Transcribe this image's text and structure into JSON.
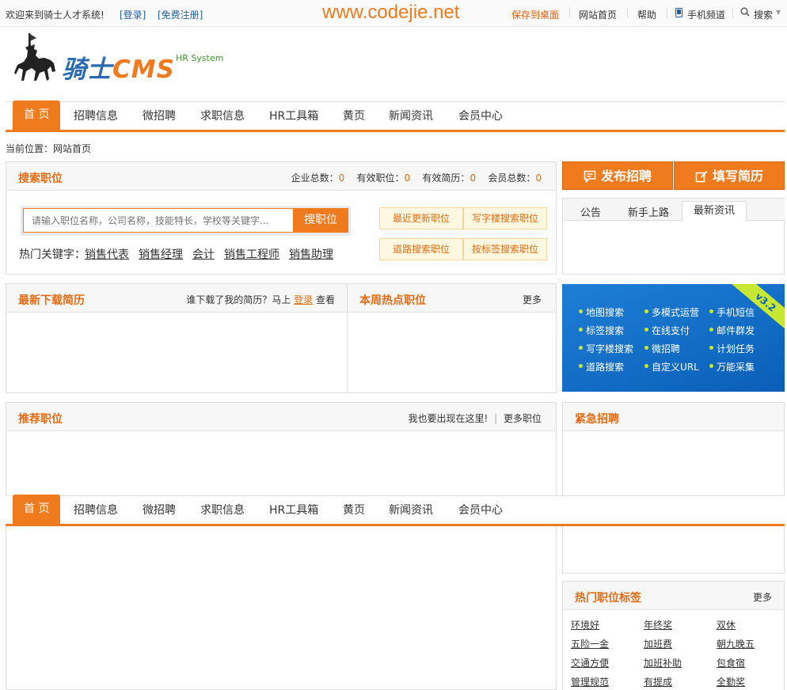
{
  "topbar": {
    "welcome": "欢迎来到骑士人才系统!",
    "login": "[登录]",
    "register": "[免费注册]",
    "brand_watermark": "www.codejie.net",
    "save_desktop": "保存到桌面",
    "home": "网站首页",
    "help": "帮助",
    "mobile": "手机频道",
    "search": "搜索"
  },
  "logo": {
    "title": "骑士",
    "title_cms": "CMS",
    "subtitle": "HR System"
  },
  "nav": {
    "items": [
      "首 页",
      "招聘信息",
      "微招聘",
      "求职信息",
      "HR工具箱",
      "黄页",
      "新闻资讯",
      "会员中心"
    ]
  },
  "breadcrumb": "当前位置：网站首页",
  "search_panel": {
    "title": "搜索职位",
    "stats": [
      {
        "label": "企业总数：",
        "value": "0"
      },
      {
        "label": "有效职位：",
        "value": "0"
      },
      {
        "label": "有效简历：",
        "value": "0"
      },
      {
        "label": "会员总数：",
        "value": "0"
      }
    ],
    "placeholder": "请输入职位名称，公司名称，技能特长，学校等关键字...",
    "button": "搜职位",
    "hot_label": "热门关键字：",
    "hot_keywords": [
      "销售代表",
      "销售经理",
      "会计",
      "销售工程师",
      "销售助理"
    ],
    "quick_links": [
      "最近更新职位",
      "写字楼搜索职位",
      "道路搜索职位",
      "按标签搜索职位"
    ]
  },
  "actions": {
    "post_job": "发布招聘",
    "write_resume": "填写简历"
  },
  "notice_tabs": [
    "公告",
    "新手上路",
    "最新资讯"
  ],
  "resume_panel": {
    "title": "最新下载简历",
    "prompt": "谁下载了我的简历？马上",
    "login": "登录",
    "view": "查看"
  },
  "hot_jobs_panel": {
    "title": "本周热点职位",
    "more": "更多"
  },
  "promo": {
    "version": "v3.2",
    "features": [
      "地图搜索",
      "多模式运营",
      "手机短信",
      "标签搜索",
      "在线支付",
      "邮件群发",
      "写字楼搜索",
      "微招聘",
      "计划任务",
      "道路搜索",
      "自定义URL",
      "万能采集"
    ]
  },
  "recommend_panel": {
    "title": "推荐职位",
    "appear": "我也要出现在这里!",
    "more": "更多职位"
  },
  "urgent_panel": {
    "title": "紧急招聘"
  },
  "tags_panel": {
    "title": "热门职位标签",
    "more": "更多",
    "tags": [
      "环境好",
      "年终奖",
      "双休",
      "五险一金",
      "加班费",
      "朝九晚五",
      "交通方便",
      "加班补助",
      "包食宿",
      "管理规范",
      "有提成",
      "全勤奖"
    ]
  },
  "colors": {
    "accent": "#f07a1e",
    "link_blue": "#1f5fa5",
    "promo_blue": "#0a5fb8",
    "promo_green": "#c6e835"
  }
}
